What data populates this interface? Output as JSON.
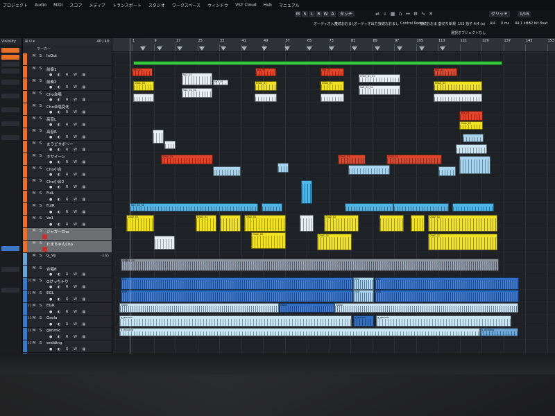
{
  "menu": [
    "プロジェクト",
    "Audio",
    "MIDI",
    "スコア",
    "メディア",
    "トランスポート",
    "スタジオ",
    "ワークスペース",
    "ウィンドウ",
    "VST Cloud",
    "Hub",
    "マニュアル"
  ],
  "toolbar": {
    "buttons": [
      "M",
      "S",
      "L",
      "R",
      "W",
      "A"
    ],
    "touch_mode": "タッチ",
    "grid_mode": "グリッド",
    "quantize": "1/16",
    "labels": [
      "オーディオ入力",
      "接続おおまし",
      "オーディオ出力",
      "接続おおまし",
      "Control Room",
      "接続おおまし",
      "音切り新規",
      "152 拍子 4/4 (x)",
      "4/4",
      "0 ms",
      "44.1 kHz",
      "32 bit float"
    ],
    "sub_label": "選択オブジェクトなし"
  },
  "inspector": {
    "title": "Visibility"
  },
  "tracklist": {
    "header_count": "40 / 40",
    "header_sub": "マーカー",
    "tracks": [
      {
        "num": "",
        "name": "InOut",
        "color": "#e8702a",
        "ms": "M S",
        "ctrl": ""
      },
      {
        "num": "",
        "name": "前奏1",
        "color": "#e8702a",
        "ms": "M S",
        "ctrl": "● ◐ R W ▦"
      },
      {
        "num": "",
        "name": "前奏2",
        "color": "#e8702a",
        "ms": "M S",
        "ctrl": "● ◐ R W ▦"
      },
      {
        "num": "",
        "name": "Cho合唱",
        "color": "#e8702a",
        "ms": "M S",
        "ctrl": "● ◐ R W ▦"
      },
      {
        "num": "",
        "name": "Cho合唱変化",
        "color": "#e8702a",
        "ms": "M S",
        "ctrl": "● ◐ R W ▦"
      },
      {
        "num": "",
        "name": "高音L",
        "color": "#e8702a",
        "ms": "M S",
        "ctrl": "● ◐ R W ▦"
      },
      {
        "num": "",
        "name": "高音R",
        "color": "#e8702a",
        "ms": "M S",
        "ctrl": "● ◐ R W ▦"
      },
      {
        "num": "",
        "name": "まラビサボ～ー",
        "color": "#e8702a",
        "ms": "M S",
        "ctrl": "● ◐ R W ▦"
      },
      {
        "num": "",
        "name": "キサイーン",
        "color": "#e8702a",
        "ms": "M S",
        "ctrl": "● ◐ R W ▦"
      },
      {
        "num": "",
        "name": "Cho小合",
        "color": "#e8702a",
        "ms": "M S",
        "ctrl": "● ◐ R W ▦"
      },
      {
        "num": "",
        "name": "Cho小合2",
        "color": "#e8702a",
        "ms": "M S",
        "ctrl": "● ◐ R W ▦"
      },
      {
        "num": "",
        "name": "FulL",
        "color": "#e8702a",
        "ms": "M S",
        "ctrl": "● ◐ R W ▦"
      },
      {
        "num": "",
        "name": "FulR",
        "color": "#e8702a",
        "ms": "M S",
        "ctrl": "● ◐ R W ▦"
      },
      {
        "num": "",
        "name": "Vo1",
        "color": "#e8702a",
        "ms": "M S",
        "ctrl": "● ◐ R W ▦"
      },
      {
        "num": "",
        "name": "ジャガーCho",
        "color": "#e8702a",
        "ms": "M S",
        "ctrl": "",
        "selected": true,
        "rec": true
      },
      {
        "num": "",
        "name": "たまちゃんCho",
        "color": "#e8702a",
        "ms": "M S",
        "ctrl": "",
        "selected": true,
        "rec": true
      },
      {
        "num": "",
        "name": "G_Vo",
        "color": "#6aa3d8",
        "ms": "M S",
        "ctrl": "",
        "val": "-3.65"
      },
      {
        "num": "",
        "name": "合唱B",
        "color": "#6aa3d8",
        "ms": "M S",
        "ctrl": "● ◐ R W ▦"
      },
      {
        "num": "20",
        "name": "Gけっちゃり",
        "color": "#3b78c8",
        "ms": "M S",
        "ctrl": "● ◐ R W ▦"
      },
      {
        "num": "21",
        "name": "EGL",
        "color": "#3b78c8",
        "ms": "M S",
        "ctrl": "● ◐ R W ▦"
      },
      {
        "num": "22",
        "name": "EGR",
        "color": "#3b78c8",
        "ms": "M S",
        "ctrl": "● ◐ R W ▦"
      },
      {
        "num": "23",
        "name": "Gsolo",
        "color": "#3b78c8",
        "ms": "M S",
        "ctrl": "● ◐ R W ▦"
      },
      {
        "num": "24",
        "name": "gimmic",
        "color": "#3b78c8",
        "ms": "M S",
        "ctrl": "● ◐ R W ▦"
      },
      {
        "num": "25",
        "name": "endding",
        "color": "#3b78c8",
        "ms": "M S",
        "ctrl": "● ◐ R W ▦"
      },
      {
        "num": "26",
        "name": "MIXBUS",
        "color": "#3b78c8",
        "ms": "M S",
        "ctrl": ""
      }
    ]
  },
  "ruler": {
    "numbers": [
      "1",
      "9",
      "17",
      "25",
      "33",
      "41",
      "49",
      "57",
      "65",
      "73",
      "81",
      "89",
      "97",
      "105",
      "113",
      "121",
      "129",
      "137",
      "145",
      "153"
    ]
  },
  "clips": {
    "green_bar": "InOut",
    "labels": [
      "Vo1_01",
      "Vo2_01",
      "Cho1_01",
      "Cho2_01",
      "Cho1_02",
      "Cho3_01_01",
      "Vo2_01_01",
      "Vo1_02_01",
      "合唱B1_04",
      "合唱B1_00",
      "合唱B1_13",
      "合唱B1_01",
      "合唱B1_03",
      "EGL",
      "EGR",
      "Gsolo",
      "g_gimmic",
      "g_endding"
    ]
  }
}
